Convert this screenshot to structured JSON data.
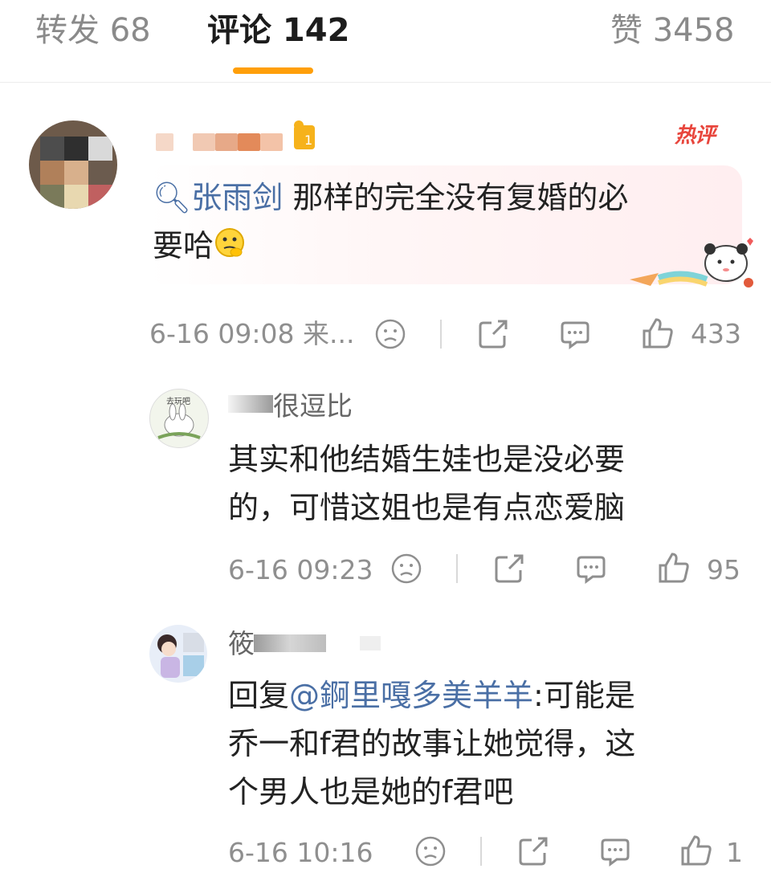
{
  "tabs": {
    "reposts": "转发 68",
    "comments": "评论 142",
    "likes": "赞 3458"
  },
  "accent_color": "#ff9f0a",
  "link_color": "#4a6fa5",
  "main_comment": {
    "badge": "热评",
    "search_keyword": "张雨剑",
    "text_line1": " 那样的完全没有复婚的必",
    "text_line2": "要哈",
    "emoji": "thinking-emoji",
    "timestamp": "6-16 09:08",
    "source": "来...",
    "like_count": "433"
  },
  "reply_1": {
    "username": "很逗比",
    "text_line1": "其实和他结婚生娃也是没必要",
    "text_line2": "的，可惜这姐也是有点恋爱脑",
    "timestamp": "6-16 09:23",
    "like_count": "95"
  },
  "reply_2": {
    "username": "筱",
    "reply_prefix": "回复",
    "mention": "@錒里嘎多美羊羊",
    "text_line1_rest": ":可能是",
    "text_line2": "乔一和f君的故事让她觉得，这",
    "text_line3": "个男人也是她的f君吧",
    "timestamp": "6-16 10:16",
    "like_count": "1"
  }
}
